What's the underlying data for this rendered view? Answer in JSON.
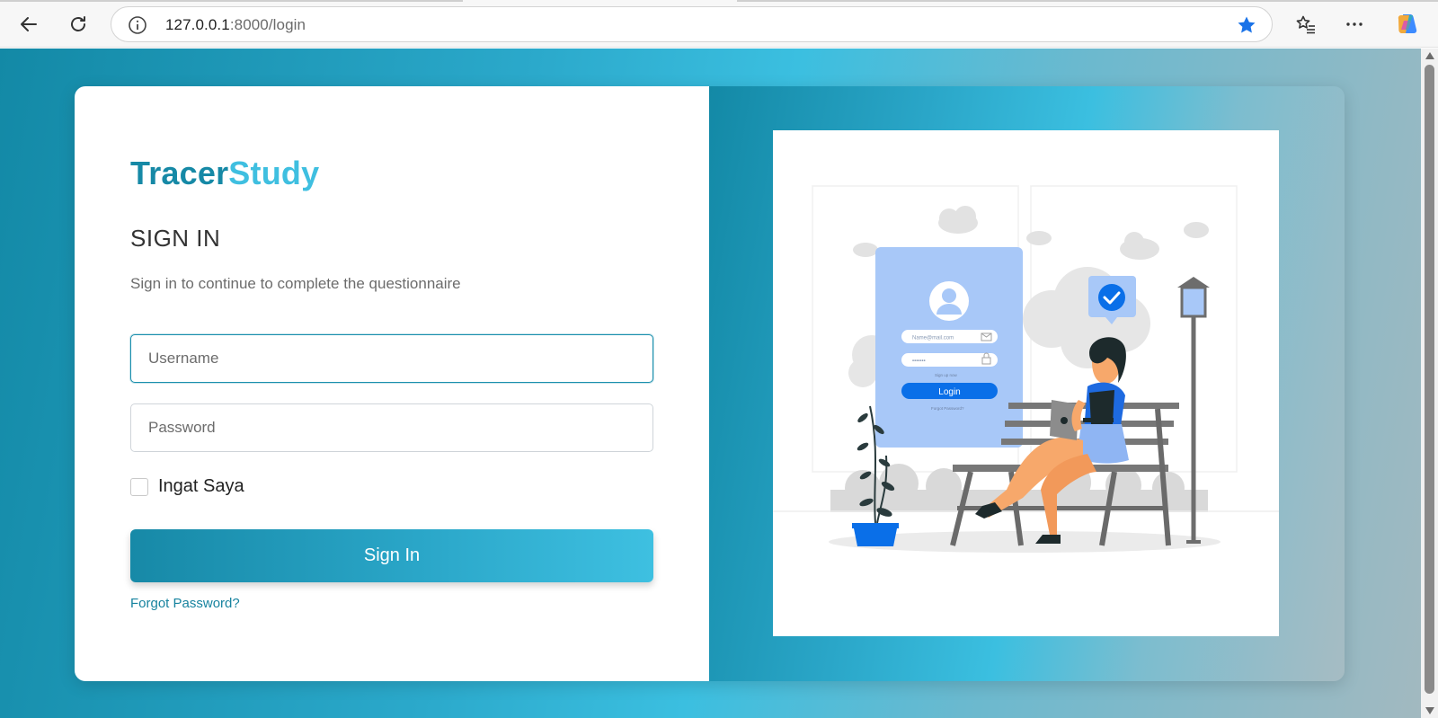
{
  "browser": {
    "url_host": "127.0.0.1",
    "url_path": ":8000/login"
  },
  "brand": {
    "part1": "Tracer",
    "part2": "Study"
  },
  "form": {
    "title": "SIGN IN",
    "subtitle": "Sign in to continue to complete the questionnaire",
    "username_placeholder": "Username",
    "password_placeholder": "Password",
    "remember_label": "Ingat Saya",
    "submit_label": "Sign In",
    "forgot_label": "Forgot Password?"
  },
  "illustration": {
    "email_placeholder": "Name@mail.com",
    "password_mask": "•••••••",
    "signup_text": "Sign up now",
    "login_label": "Login",
    "forgot_text": "Forgot Password?"
  },
  "colors": {
    "brand_primary": "#1689a6",
    "brand_secondary": "#3fbfe0",
    "star_blue": "#1a73e8",
    "illustration_blue": "#0a6fe8"
  }
}
